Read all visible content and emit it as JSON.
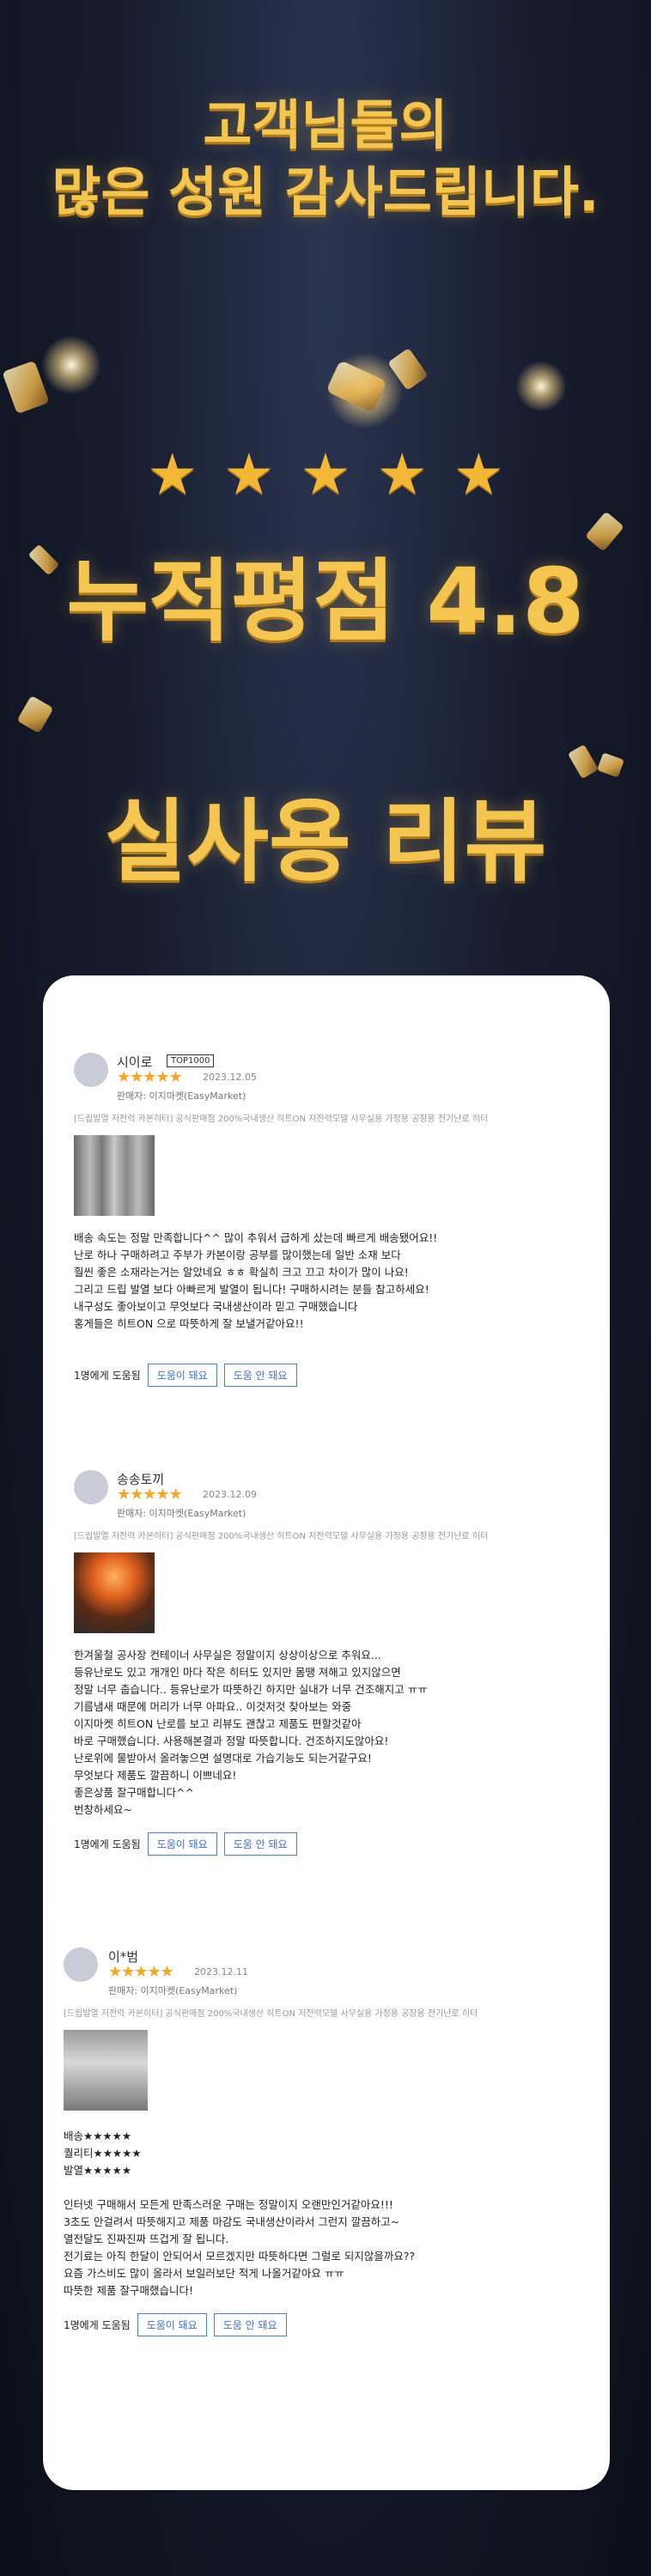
{
  "hero": {
    "line1": "고객님들의",
    "line2": "많은 성원 감사드립니다.",
    "rating_stars": [
      "★",
      "★",
      "★",
      "★",
      "★"
    ],
    "rating_text": "누적평점 4.8",
    "section_title": "실사용 리뷰"
  },
  "reviews": [
    {
      "name": "시이로",
      "badge": "TOP1000",
      "stars": "★★★★★",
      "date": "2023.12.05",
      "seller": "판매자: 이지마켓(EasyMarket)",
      "product": "[드립발열 저전력 카본히터] 공식판매점 200%국내생산 히트ON 저전력모델 사무실용 가정용 공장용 전기난로 히터",
      "body": "배송 속도는 정말 만족합니다^^ 많이 추워서 급하게 샀는데 빠르게 배송됐어요!!\n난로 하나 구매하려고 주부가 카본이랑 공부를 많이했는데 일반 소재 보다\n훨씬 좋은 소재라는거는 알았네요 ㅎㅎ 확실히 크고 끄고 차이가 많이 나요!\n그리고 드립 발열 보다 아빠르게 발열이 됩니다! 구매하시려는 분들 참고하세요!\n내구성도 좋아보이고 무엇보다 국내생산이라 믿고 구매했습니다\n홍게들은 히트ON 으로 따뜻하게 잘 보낼거같아요!!",
      "helpful": "1명에게 도움됨",
      "yes": "도움이 돼요",
      "no": "도움 안 돼요"
    },
    {
      "name": "송송토끼",
      "stars": "★★★★★",
      "date": "2023.12.09",
      "seller": "판매자: 이지마켓(EasyMarket)",
      "product": "[드립발열 저전력 카본히터] 공식판매점 200%국내생산 히트ON 저전력모델 사무실용 가정용 공장용 전기난로 히터",
      "body": "한겨울철 공사장 컨테이너 사무실은 정말이지 상상이상으로 추워요...\n등유난로도 있고 개개인 마다 작은 히터도 있지만 몸땡 져해고 있지않으면\n정말 너무 춥습니다.. 등유난로가 따뜻하긴 하지만 실내가 너무 건조해지고 ㅠㅠ\n기름냄새 때문에 머리가 너무 아파요.. 이것저것 찾아보는 와중\n이지마켓 히트ON 난로를 보고 리뷰도 괜찮고 제품도 편할것같아\n바로 구매했습니다. 사용해본결과 정말 따뜻합니다. 건조하지도않아요!\n난로위에 물받아서 올려놓으면 설명대로 가습기능도 되는거같구요!\n무엇보다 제품도 깔끔하니 이쁘네요!\n좋은상품 잘구매합니다^^\n번창하세요~",
      "helpful": "1명에게 도움됨",
      "yes": "도움이 돼요",
      "no": "도움 안 돼요"
    },
    {
      "name": "이*범",
      "stars": "★★★★★",
      "date": "2023.12.11",
      "seller": "판매자: 이지마켓(EasyMarket)",
      "product": "[드립발열 저전력 카본히터] 공식판매점 200%국내생산 히트ON 저전력모델 사무실용 가정용 공장용 전기난로 히터",
      "body": "배송★★★★★\n퀄리티★★★★★\n발열★★★★★\n\n인터넷 구매해서 모든게 만족스러운 구매는 정말이지 오랜만인거같아요!!!\n3초도 안걸려서 따뜻해지고 제품 마감도 국내생산이라서 그런지 깔끔하고~\n열전달도 진짜진짜 뜨겁게 잘 됩니다.\n전기료는 아직 한달이 안되어서 모르겠지만 따뜻하다면 그럴로 되지않을까요??\n요즘 가스비도 많이 올라서 보일러보단 적게 나올거같아요 ㅠㅠ\n따뜻한 제품 잘구매했습니다!",
      "helpful": "1명에게 도움됨",
      "yes": "도움이 돼요",
      "no": "도움 안 돼요"
    }
  ]
}
